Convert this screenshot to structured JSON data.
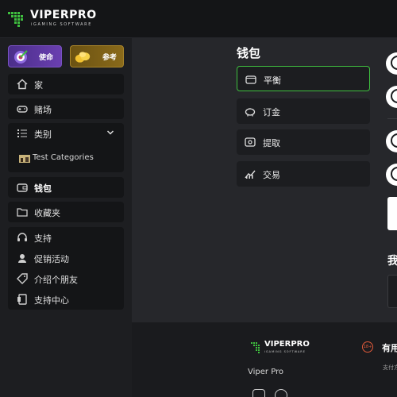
{
  "brand": {
    "name": "VIPERPRO",
    "tagline": "iGAMING SOFTWARE"
  },
  "sidebar": {
    "promos": [
      {
        "label": "使命",
        "icon": "target-icon"
      },
      {
        "label": "参考",
        "icon": "coins-icon"
      }
    ],
    "nav": {
      "home": "家",
      "casino": "赌场",
      "categories": "类别",
      "test_categories": "Test Categories",
      "wallet": "钱包",
      "favorites": "收藏夹",
      "support": "支持",
      "promotions": "促销活动",
      "refer": "介绍个朋友",
      "help_center": "支持中心"
    }
  },
  "main": {
    "title": "钱包",
    "menu": [
      {
        "label": "平衡",
        "icon": "wallet-icon"
      },
      {
        "label": "订金",
        "icon": "piggy-bank-icon"
      },
      {
        "label": "提取",
        "icon": "withdraw-icon"
      },
      {
        "label": "交易",
        "icon": "chart-icon"
      }
    ],
    "right_title": "我"
  },
  "footer": {
    "brand": "VIPERPRO",
    "tagline": "iGAMING SOFTWARE",
    "site_name": "Viper Pro",
    "age_badge": "18+",
    "heading": "有用",
    "sub": "支付方"
  },
  "colors": {
    "accent_green": "#3fbf3f",
    "mission_purple": "#6a3fb0",
    "ref_gold": "#a8842a"
  }
}
